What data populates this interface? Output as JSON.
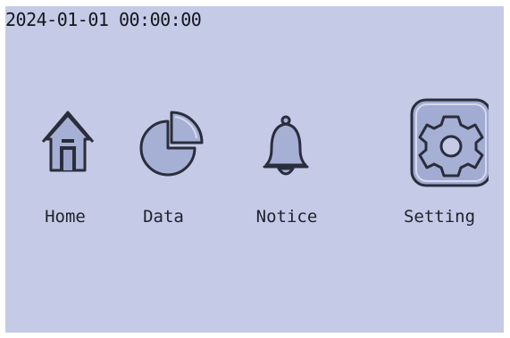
{
  "status_bar": {
    "datetime": "2024-01-01 00:00:00"
  },
  "menu": {
    "items": [
      {
        "label": "Home",
        "icon": "home-icon",
        "selected": false
      },
      {
        "label": "Data",
        "icon": "pie-chart-icon",
        "selected": false
      },
      {
        "label": "Notice",
        "icon": "bell-icon",
        "selected": false
      },
      {
        "label": "Setting",
        "icon": "gear-icon",
        "selected": true
      }
    ]
  },
  "colors": {
    "screen_background": "#c5cbe6",
    "icon_fill": "#a6b0d4",
    "icon_stroke": "#2a2d3c",
    "selection_fill": "#a2acd2"
  }
}
